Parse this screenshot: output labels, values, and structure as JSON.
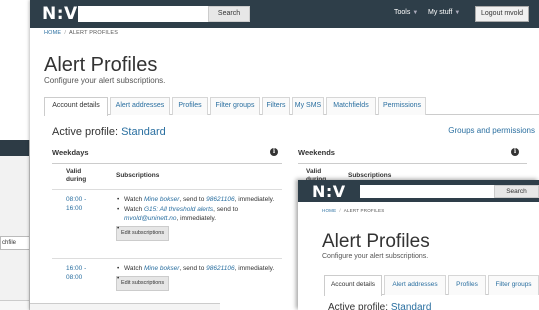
{
  "bg_window": {
    "cell_text": "chfile"
  },
  "main": {
    "logo": "N:V",
    "search_button": "Search",
    "menu": {
      "tools": "Tools",
      "my_stuff": "My stuff",
      "logout": "Logout mvold"
    },
    "breadcrumb": {
      "home": "HOME",
      "current": "ALERT PROFILES"
    },
    "title": "Alert Profiles",
    "subtitle": "Configure your alert subscriptions.",
    "tabs": [
      {
        "label": "Account details"
      },
      {
        "label": "Alert addresses"
      },
      {
        "label": "Profiles"
      },
      {
        "label": "Filter groups"
      },
      {
        "label": "Filters"
      },
      {
        "label": "My SMS"
      },
      {
        "label": "Matchfields"
      },
      {
        "label": "Permissions"
      }
    ],
    "active_profile_label": "Active profile:",
    "active_profile_name": "Standard",
    "groups_link": "Groups and permissions",
    "weekdays": {
      "heading": "Weekdays",
      "col_valid": "Valid during",
      "col_subs": "Subscriptions",
      "rows": [
        {
          "time": "08:00 - 16:00",
          "items": [
            {
              "pre": "Watch ",
              "link": "Mine bokser",
              "mid": ", send to ",
              "link2": "98621106",
              "post": ", immediately."
            },
            {
              "pre": "Watch ",
              "link": "G15: All threshold alerts",
              "mid": ", send to ",
              "link2": "mvold@uninett.no",
              "post": ", immediately."
            }
          ],
          "button": "Edit subscriptions"
        },
        {
          "time": "16:00 - 08:00",
          "items": [
            {
              "pre": "Watch ",
              "link": "Mine bokser",
              "mid": ", send to ",
              "link2": "98621106",
              "post": ", immediately."
            }
          ],
          "button": "Edit subscriptions"
        }
      ]
    },
    "weekends": {
      "heading": "Weekends",
      "col_valid": "Valid during",
      "col_subs": "Subscriptions"
    }
  },
  "overlay": {
    "logo": "N:V",
    "search_button": "Search",
    "breadcrumb": {
      "home": "HOME",
      "current": "ALERT PROFILES"
    },
    "title": "Alert Profiles",
    "subtitle": "Configure your alert subscriptions.",
    "tabs": [
      {
        "label": "Account details"
      },
      {
        "label": "Alert addresses"
      },
      {
        "label": "Profiles"
      },
      {
        "label": "Filter groups"
      }
    ],
    "active_profile_label": "Active profile:",
    "active_profile_name": "Standard"
  }
}
